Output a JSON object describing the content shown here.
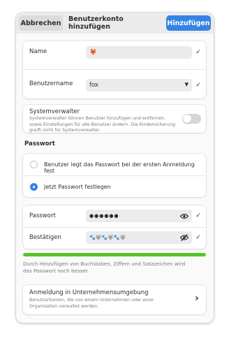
{
  "header": {
    "cancel_label": "Abbrechen",
    "title": "Benutzerkonto hinzufügen",
    "add_label": "Hinzufügen"
  },
  "name_row": {
    "label": "Name",
    "value": "🦊"
  },
  "username_row": {
    "label": "Benutzername",
    "value": "fox"
  },
  "admin": {
    "title": "Systemverwalter",
    "description": "Systemverwalter können Benutzer hinzufügen und entfernen, sowie Einstellungen für alle Benutzer ändern. Die Kindersicherung greift nicht für Systemverwalter.",
    "enabled": false
  },
  "password_section": {
    "title": "Passwort",
    "option_later": "Benutzer legt das Passwort bei der ersten Anmeldung fest",
    "option_now": "Jetzt Passwort festlegen",
    "selected": "now"
  },
  "password_row": {
    "label": "Passwort",
    "value": "●●●●●●"
  },
  "confirm_row": {
    "label": "Bestätigen",
    "value": "🐾🐺🐾🐺🐾🐺"
  },
  "strength": {
    "fraction": 1.0,
    "hint": "Durch Hinzufügen von Buchstaben, Ziffern und Satzzeichen wird das Passwort noch besser."
  },
  "enterprise": {
    "title": "Anmeldung in Unternehmensumgebung",
    "description": "Benutzerkonten, die von einem Unternehmen oder einer Organisation verwaltet werden."
  },
  "icons": {
    "check": "✓",
    "dropdown": "▾",
    "chevron": "›"
  },
  "colors": {
    "accent": "#3584e4",
    "strength": "#56c527"
  }
}
